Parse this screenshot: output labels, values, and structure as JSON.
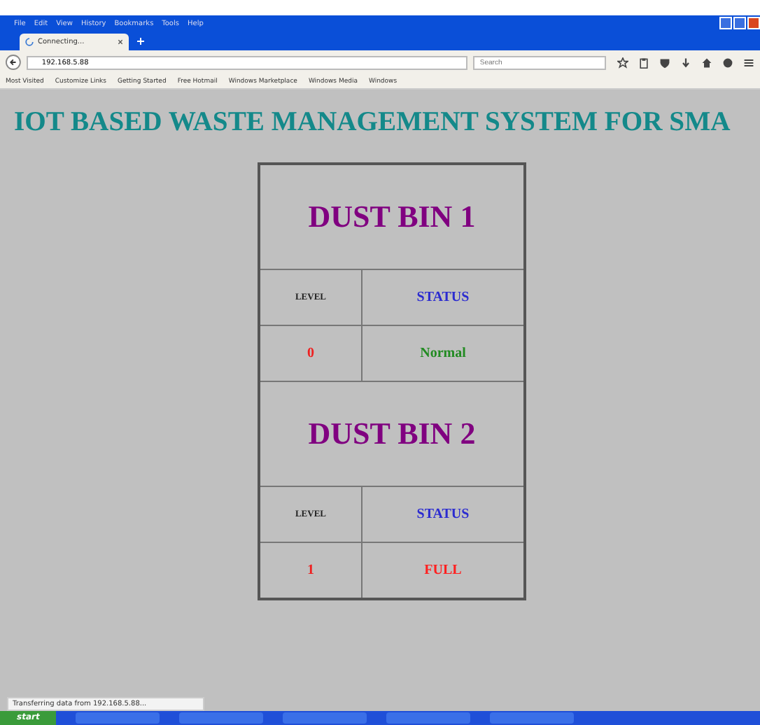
{
  "browser": {
    "menu": [
      "File",
      "Edit",
      "View",
      "History",
      "Bookmarks",
      "Tools",
      "Help"
    ],
    "tabs": [
      {
        "label": "Connecting...",
        "selected": true
      }
    ],
    "address": "192.168.5.88",
    "search": {
      "placeholder": "Search"
    },
    "bookmarks": [
      "Most Visited",
      "Customize Links",
      "Getting Started",
      "Free Hotmail",
      "Windows Marketplace",
      "Windows Media",
      "Windows"
    ],
    "status_text": "Transferring data from 192.168.5.88..."
  },
  "page": {
    "heading": "IOT BASED WASTE MANAGEMENT SYSTEM FOR SMA",
    "bins": [
      {
        "title": "DUST BIN 1",
        "level_label": "LEVEL",
        "status_label": "STATUS",
        "level_value": "0",
        "status": {
          "text": "Normal",
          "color": "#228b22"
        }
      },
      {
        "title": "DUST BIN 2",
        "level_label": "LEVEL",
        "status_label": "STATUS",
        "level_value": "1",
        "status": {
          "text": "FULL",
          "color": "#ff2020"
        }
      }
    ]
  },
  "taskbar": {
    "start": "start"
  }
}
